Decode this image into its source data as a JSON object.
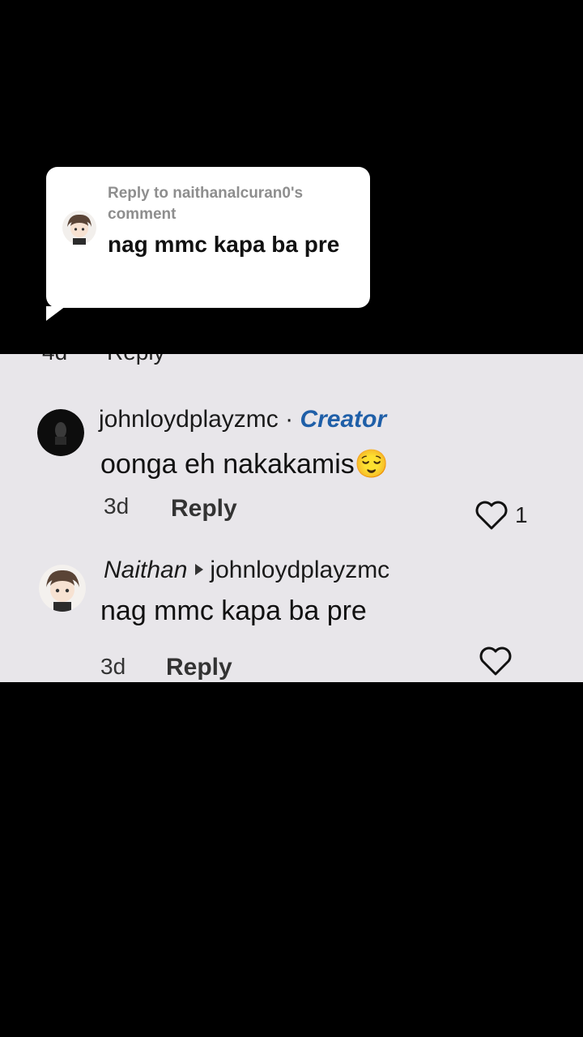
{
  "reply_bubble": {
    "meta": "Reply to naithanalcuran0's comment",
    "text": "nag mmc kapa ba pre"
  },
  "partial_row": {
    "time": "4d",
    "reply": "Reply"
  },
  "comments": [
    {
      "username": "johnloydplayzmc",
      "separator": "·",
      "badge": "Creator",
      "text": "oonga eh nakakamis",
      "emoji": "😌",
      "time": "3d",
      "reply_label": "Reply",
      "likes": "1"
    },
    {
      "username": "Naithan",
      "reply_to": "johnloydplayzmc",
      "text": "nag mmc kapa ba pre",
      "time": "3d",
      "reply_label": "Reply"
    }
  ],
  "colors": {
    "creator_badge": "#1f5fa8",
    "panel_bg": "#e8e6ea",
    "bubble_bg": "#ffffff",
    "like_red": "#e8452c"
  }
}
